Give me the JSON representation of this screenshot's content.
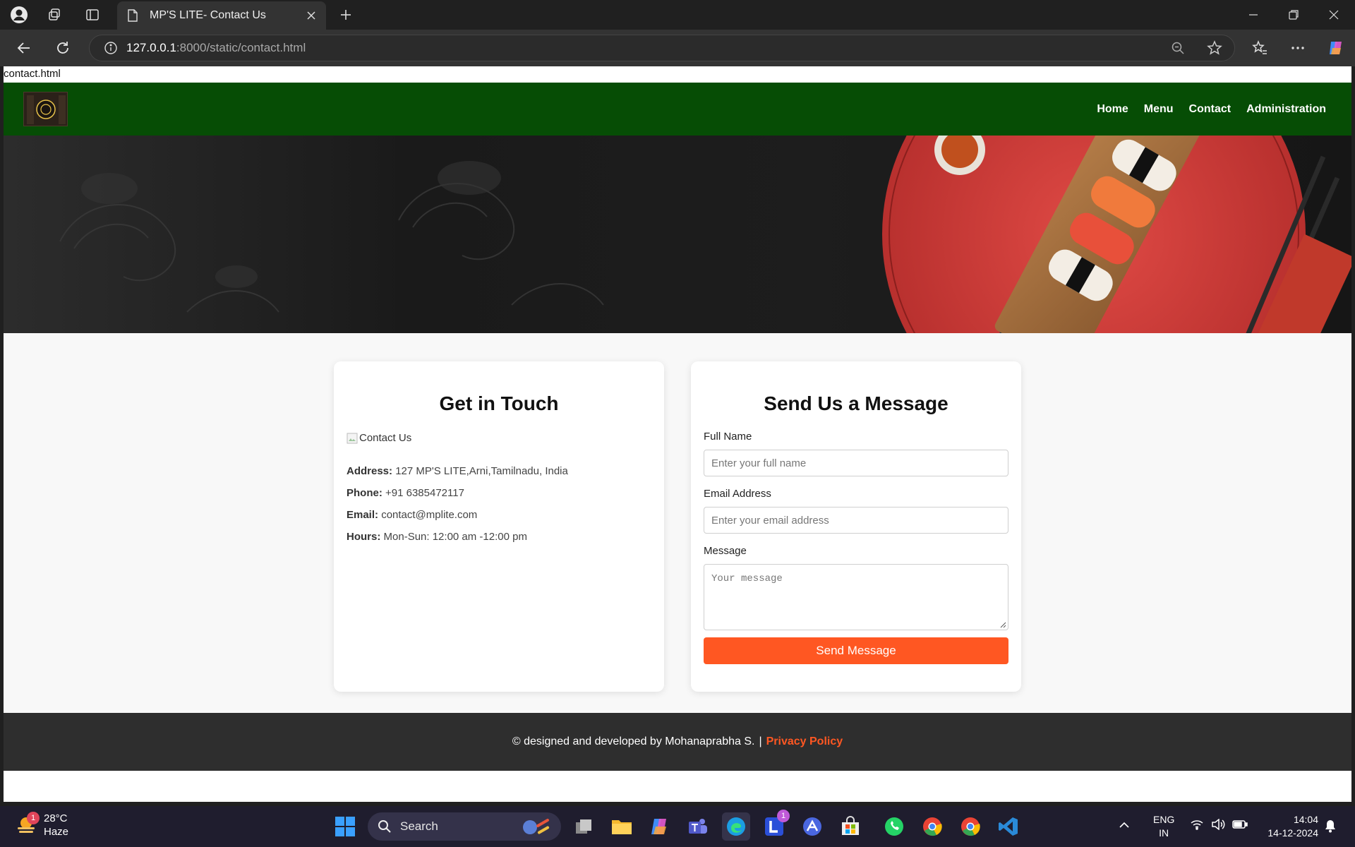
{
  "browser": {
    "tab_title": "MP'S LITE- Contact Us",
    "url_host": "127.0.0.1",
    "url_rest": ":8000/static/contact.html"
  },
  "page": {
    "file_label": "contact.html",
    "nav": [
      "Home",
      "Menu",
      "Contact",
      "Administration"
    ],
    "info_card": {
      "heading": "Get in Touch",
      "image_alt": "Contact Us",
      "address_label": "Address:",
      "address": "127 MP'S LITE,Arni,Tamilnadu, India",
      "phone_label": "Phone:",
      "phone": "+91 6385472117",
      "email_label": "Email:",
      "email": "contact@mplite.com",
      "hours_label": "Hours:",
      "hours": "Mon-Sun: 12:00 am -12:00 pm"
    },
    "form_card": {
      "heading": "Send Us a Message",
      "name_label": "Full Name",
      "name_placeholder": "Enter your full name",
      "email_label": "Email Address",
      "email_placeholder": "Enter your email address",
      "message_label": "Message",
      "message_placeholder": "Your message",
      "submit_label": "Send Message"
    },
    "footer": {
      "credit": "© designed and developed by Mohanaprabha S.",
      "separator": "|",
      "privacy": "Privacy Policy"
    }
  },
  "taskbar": {
    "weather_temp": "28°C",
    "weather_desc": "Haze",
    "weather_badge": "1",
    "search_label": "Search",
    "app_badge": "1",
    "lang_line1": "ENG",
    "lang_line2": "IN",
    "time": "14:04",
    "date": "14-12-2024"
  },
  "colors": {
    "header_green": "#064d05",
    "accent_orange": "#ff5722",
    "footer_bg": "#2e2e2e"
  }
}
